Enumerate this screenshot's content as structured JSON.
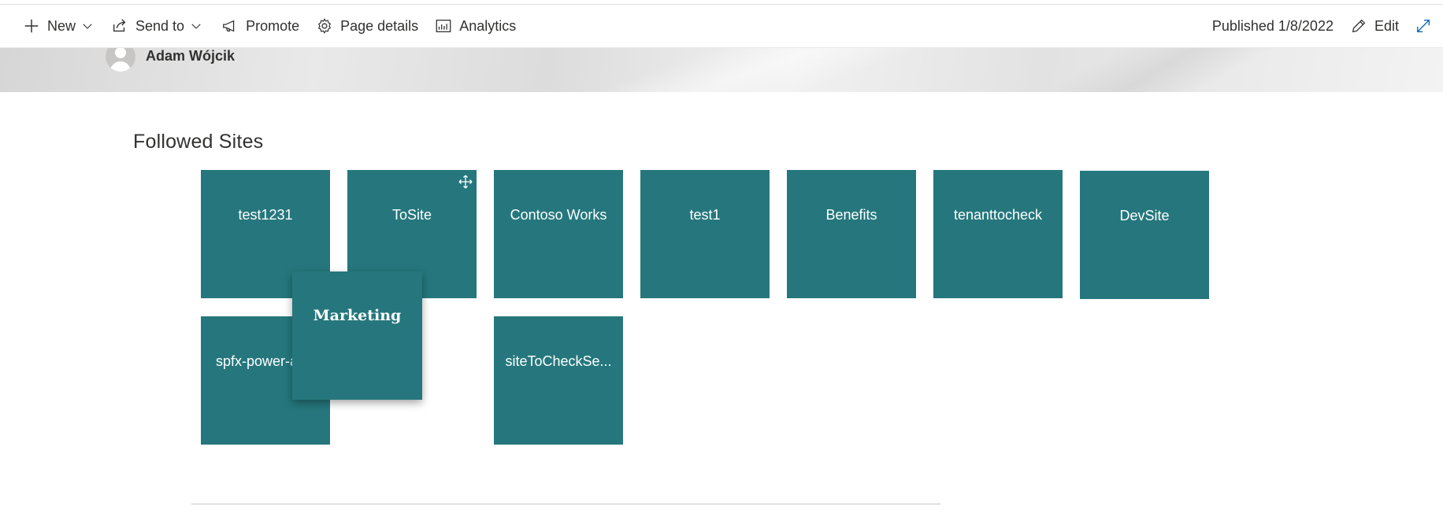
{
  "toolbar": {
    "new_label": "New",
    "send_to_label": "Send to",
    "promote_label": "Promote",
    "page_details_label": "Page details",
    "analytics_label": "Analytics",
    "published_label": "Published 1/8/2022",
    "edit_label": "Edit",
    "icons": [
      "plus-icon",
      "chevron-down-icon",
      "share-icon",
      "megaphone-icon",
      "gear-icon",
      "chart-icon",
      "pencil-icon",
      "expand-icon"
    ]
  },
  "header": {
    "author_name": "Adam Wójcik"
  },
  "followed_sites": {
    "title": "Followed Sites",
    "tiles": [
      {
        "label": "test1231"
      },
      {
        "label": "ToSite"
      },
      {
        "label": "Contoso Works"
      },
      {
        "label": "test1"
      },
      {
        "label": "Benefits"
      },
      {
        "label": "tenanttocheck"
      },
      {
        "label": "DevSite"
      },
      {
        "label": "spfx-power-a"
      },
      {
        "label": "siteToCheckSe..."
      }
    ],
    "dragging_tile": {
      "label": "Marketing"
    },
    "tile_color": "#25777d"
  },
  "colors": {
    "accent": "#25777d",
    "text": "#323130",
    "icon": "#0f6cbd"
  }
}
